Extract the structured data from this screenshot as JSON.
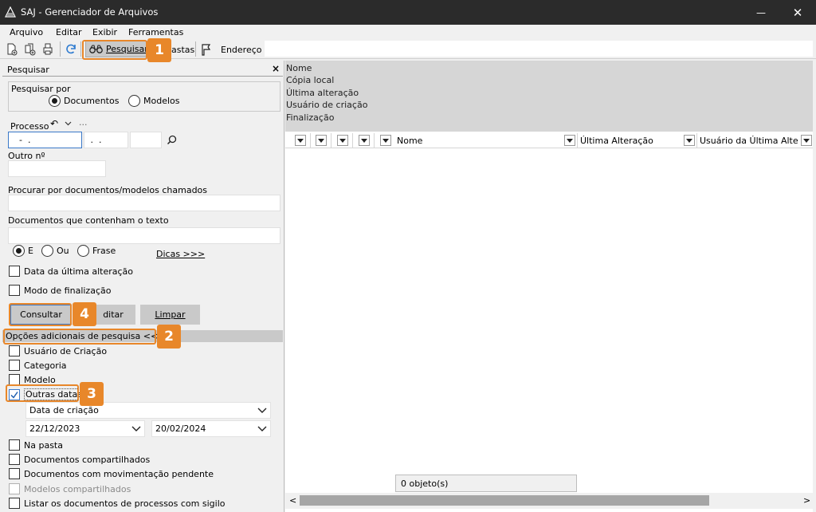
{
  "window": {
    "title": "SAJ - Gerenciador de Arquivos",
    "minimize_glyph": "—",
    "close_glyph": "✕"
  },
  "menu": [
    {
      "label": "Arquivo"
    },
    {
      "label": "Editar"
    },
    {
      "label": "Exibir"
    },
    {
      "label": "Ferramentas"
    }
  ],
  "toolbar": {
    "search_label": "Pesquisar",
    "folders_label": "astas",
    "address_label": "Endereço",
    "address_value": ""
  },
  "search_panel": {
    "title": "Pesquisar",
    "close_glyph": "×",
    "search_by_label": "Pesquisar por",
    "radio_documents": "Documentos",
    "radio_models": "Modelos",
    "process_label": "Processo",
    "process_more": "···",
    "process_part1": "  -  .",
    "process_part2": " .  .",
    "process_part3": "",
    "other_number_label": "Outro nº",
    "search_named_label": "Procurar por documentos/modelos chamados",
    "contains_text_label": "Documentos que contenham o texto",
    "op_e": "E",
    "op_ou": "Ou",
    "op_frase": "Frase",
    "tips_link": "Dicas >>>",
    "chk_last_change": "Data da última alteração",
    "chk_finalization_mode": "Modo de finalização",
    "btn_consult": "Consultar",
    "btn_edit": "ditar",
    "btn_clear": "Limpar",
    "additional_options_label": "Opções adicionais de pesquisa <<<",
    "chk_creation_user": "Usuário de Criação",
    "chk_category": "Categoria",
    "chk_model": "Modelo",
    "chk_other_dates": "Outras datas",
    "date_type": "Data de criação",
    "date_from": "22/12/2023",
    "date_to": "20/02/2024",
    "chk_in_folder": "Na pasta",
    "chk_shared_docs": "Documentos compartilhados",
    "chk_pending_docs": "Documentos com movimentação pendente",
    "chk_shared_models": "Modelos compartilhados",
    "chk_secret_process": "Listar os documentos de processos com sigilo"
  },
  "callouts": [
    "1",
    "2",
    "3",
    "4"
  ],
  "properties": [
    "Nome",
    "Cópia local",
    "Última alteração",
    "Usuário de criação",
    "Finalização"
  ],
  "grid": {
    "columns": [
      "Nome",
      "Última Alteração",
      "Usuário da Última Alter..."
    ]
  },
  "status": {
    "count_text": "0 objeto(s)"
  },
  "scroll": {
    "left_glyph": "<",
    "right_glyph": ">"
  },
  "colors": {
    "accent": "#e8872a",
    "titlebar": "#2b2b2b",
    "focus": "#3a78c8"
  }
}
